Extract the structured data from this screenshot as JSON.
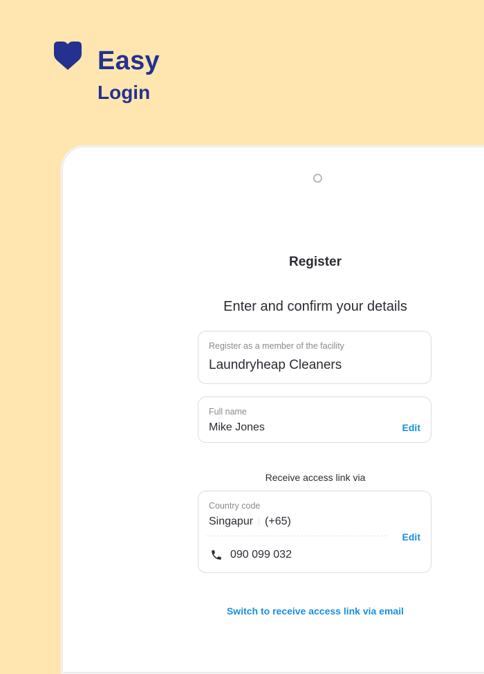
{
  "brand": {
    "title": "Easy",
    "subtitle": "Login",
    "color": "#24318f"
  },
  "screen": {
    "title": "Register",
    "subtitle": "Enter and confirm your details",
    "facility": {
      "label": "Register as a member of the facility",
      "value": "Laundryheap Cleaners"
    },
    "full_name": {
      "label": "Full name",
      "value": "Mike Jones",
      "edit_label": "Edit"
    },
    "access_link_label": "Receive access link via",
    "phone": {
      "country_label": "Country code",
      "country_name": "Singapur",
      "country_dial": "(+65)",
      "number": "090 099 032",
      "edit_label": "Edit",
      "icon": "phone-icon"
    },
    "switch_link": "Switch to receive access link via email"
  },
  "colors": {
    "background": "#FFE6B0",
    "accent": "#1a8fdc"
  }
}
